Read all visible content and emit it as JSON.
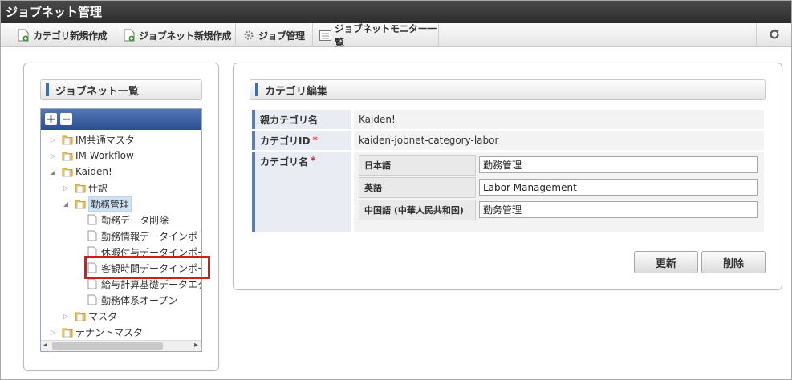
{
  "app": {
    "title": "ジョブネット管理"
  },
  "toolbar": {
    "items": [
      {
        "label": "カテゴリ新規作成",
        "icon": "add-document-icon"
      },
      {
        "label": "ジョブネット新規作成",
        "icon": "add-document-icon"
      },
      {
        "label": "ジョブ管理",
        "icon": "gear-icon"
      },
      {
        "label": "ジョブネットモニター一覧",
        "icon": "monitor-list-icon"
      }
    ],
    "refresh_icon": "refresh-icon"
  },
  "left": {
    "heading": "ジョブネット一覧",
    "tools": {
      "expand": "+",
      "collapse": "−"
    },
    "tree": [
      {
        "label": "IM共通マスタ",
        "toggle": "▷",
        "type": "folder"
      },
      {
        "label": "IM-Workflow",
        "toggle": "▷",
        "type": "folder"
      },
      {
        "label": "Kaiden!",
        "toggle": "◢",
        "type": "folder"
      },
      {
        "label": "仕訳",
        "toggle": "▷",
        "type": "folder"
      },
      {
        "label": "勤務管理",
        "toggle": "◢",
        "type": "folder",
        "selected": true
      },
      {
        "label": "勤務データ削除",
        "toggle": "",
        "type": "page"
      },
      {
        "label": "勤務情報データインポー",
        "toggle": "",
        "type": "page"
      },
      {
        "label": "休暇付与データインポー",
        "toggle": "",
        "type": "page"
      },
      {
        "label": "客観時間データインポー",
        "toggle": "",
        "type": "page",
        "highlighted": true
      },
      {
        "label": "給与計算基礎データエク",
        "toggle": "",
        "type": "page"
      },
      {
        "label": "勤務体系オープン",
        "toggle": "",
        "type": "page"
      },
      {
        "label": "マスタ",
        "toggle": "▷",
        "type": "folder"
      },
      {
        "label": "テナントマスタ",
        "toggle": "▷",
        "type": "folder"
      }
    ],
    "scroll": {
      "left_arrow": "◂",
      "right_arrow": "▸"
    }
  },
  "right": {
    "heading": "カテゴリ編集",
    "fields": {
      "parent": {
        "label": "親カテゴリ名",
        "value": "Kaiden!"
      },
      "category_id": {
        "label": "カテゴリID",
        "required": "*",
        "value": "kaiden-jobnet-category-labor"
      },
      "category_name": {
        "label": "カテゴリ名",
        "required": "*",
        "langs": [
          {
            "label": "日本語",
            "value": "勤務管理"
          },
          {
            "label": "英語",
            "value": "Labor Management"
          },
          {
            "label": "中国語 (中華人民共和国)",
            "value": "勤务管理"
          }
        ]
      }
    },
    "buttons": {
      "update": "更新",
      "delete": "削除"
    }
  },
  "colors": {
    "accent": "#3d6fb2",
    "highlight_border": "#cc1f1f",
    "titlebar": "#333333"
  }
}
